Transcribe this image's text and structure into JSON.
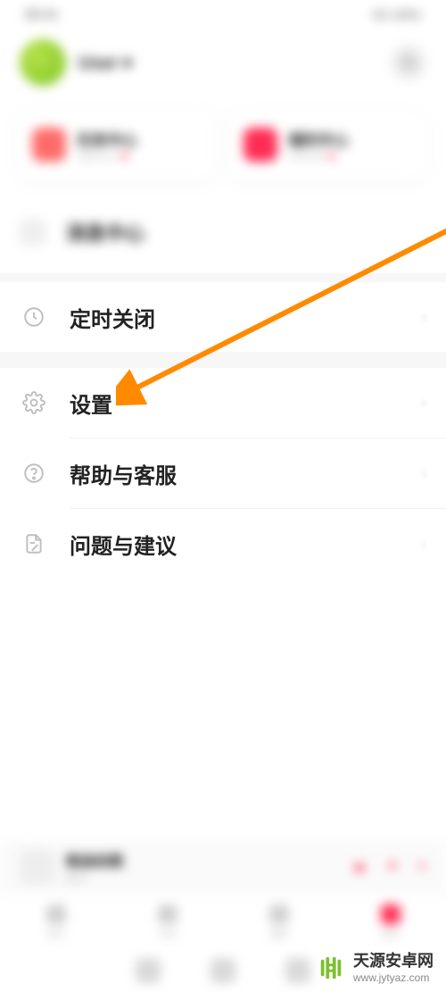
{
  "statusbar": {
    "time": "09:41",
    "right": "5G 100%"
  },
  "profile": {
    "username": "User ▾"
  },
  "cards": {
    "a": {
      "title": "任务中心",
      "sub": "signed in"
    },
    "b": {
      "title": "福利中心",
      "sub": "rewards"
    }
  },
  "msgRow": {
    "label": "消息中心"
  },
  "items": {
    "timer": "定时关闭",
    "settings": "设置",
    "help": "帮助与客服",
    "feedback": "问题与建议"
  },
  "player": {
    "title": "歌曲标题",
    "sub": "歌手"
  },
  "nav": {
    "a": "首页",
    "b": "分类",
    "c": "播客",
    "d": "我的"
  },
  "watermark": {
    "title": "天源安卓网",
    "url": "www.jytyaz.com"
  }
}
